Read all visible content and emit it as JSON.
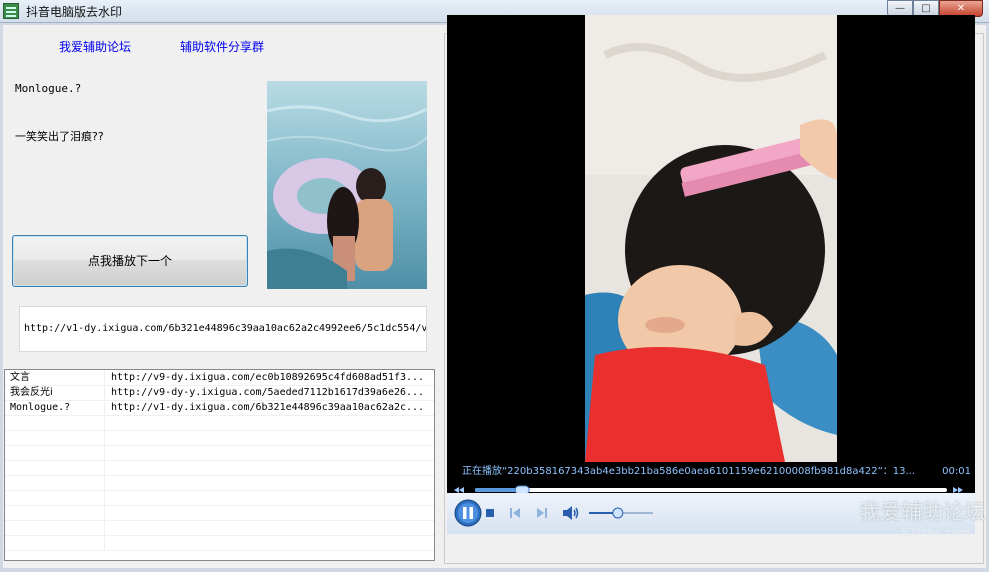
{
  "window": {
    "title": "抖音电脑版去水印",
    "minimize_label": "—",
    "maximize_label": "□",
    "close_label": "✕"
  },
  "links": {
    "forum": "我爱辅助论坛",
    "share_group": "辅助软件分享群"
  },
  "video_info": {
    "author": "Monlogue.?",
    "caption": "一笑笑出了泪痕??"
  },
  "play_next_button": "点我播放下一个",
  "current_url": "http://v1-dy.ixigua.com/6b321e44896c39aa10ac62a2c4992ee6/5c1dc554/v",
  "video_list": [
    {
      "author": "文言",
      "url": "http://v9-dy.ixigua.com/ec0b10892695c4fd608ad51f3..."
    },
    {
      "author": "我会反光i",
      "url": "http://v9-dy-y.ixigua.com/5aeded7112b1617d39a6e26..."
    },
    {
      "author": "Monlogue.?",
      "url": "http://v1-dy.ixigua.com/6b321e44896c39aa10ac62a2c..."
    }
  ],
  "player": {
    "status": "正在播放“220b358167343ab4e3bb21ba586e0aea6101159e62100008fb981d8a422”：13...",
    "time": "00:01",
    "progress": 0.1,
    "volume": 0.45
  },
  "watermark": {
    "line1": "我爱辅助论坛",
    "line2": "52fzba.com"
  },
  "colors": {
    "link": "#0000ee",
    "status_text": "#8ec3ff",
    "button_border": "#3c7fb1"
  }
}
